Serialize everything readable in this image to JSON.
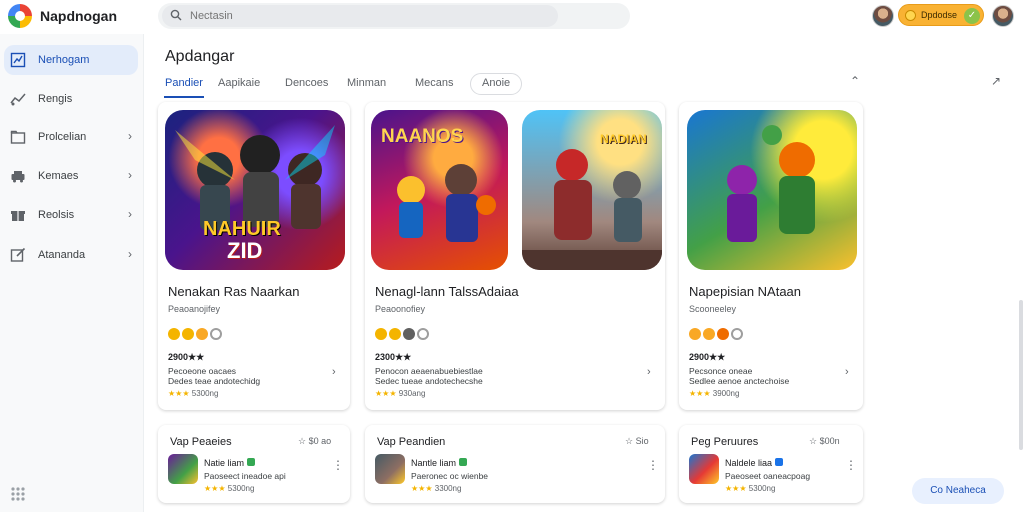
{
  "app": {
    "title": "Napdnogan"
  },
  "search": {
    "placeholder": "Nectasin",
    "value": ""
  },
  "header": {
    "points_label": "Dpdodse"
  },
  "sidebar": {
    "items": [
      {
        "label": "Nerhogam",
        "active": true,
        "icon": "chart-icon",
        "has_chevron": false
      },
      {
        "label": "Rengis",
        "active": false,
        "icon": "trend-icon",
        "has_chevron": false
      },
      {
        "label": "Prolcelian",
        "active": false,
        "icon": "folder-icon",
        "has_chevron": true
      },
      {
        "label": "Kemaes",
        "active": false,
        "icon": "car-icon",
        "has_chevron": true
      },
      {
        "label": "Reolsis",
        "active": false,
        "icon": "gift-icon",
        "has_chevron": true
      },
      {
        "label": "Atananda",
        "active": false,
        "icon": "edit-icon",
        "has_chevron": true
      }
    ]
  },
  "main": {
    "section_title": "Apdangar",
    "tabs": [
      "Pandier",
      "Aapikaie",
      "Dencoes",
      "Minman",
      "Mecans",
      "Anoie"
    ]
  },
  "cards": [
    {
      "art_text_top": "NAHUIR",
      "art_text_bottom": "ZID",
      "title": "Nenakan Ras Naarkan",
      "subtitle": "Peaoanojifey",
      "rating_dots": [
        "#f4b400",
        "#f4b400",
        "#f9a825",
        "#9e9e9e"
      ],
      "meta_strong": "2900★★",
      "meta_line1": "Pecoeone oacaes",
      "meta_line2": "Dedes teae andotechidg",
      "meta_rating": "5300ng",
      "colors": {
        "bg1": "#1a237e",
        "bg2": "#b71c1c",
        "accent": "#ffca28"
      }
    },
    {
      "art_text_top": "NAANOS",
      "title": "Nenagl-lann TalssAdaiaa",
      "subtitle": "Peaoonofiey",
      "rating_dots": [
        "#f4b400",
        "#f4b400",
        "#616161",
        "#9e9e9e"
      ],
      "meta_strong": "2300★★",
      "meta_line1": "Penocon aeaenabuebiestlae",
      "meta_line2": "Sedec tueae andotechecshe",
      "meta_rating": "930ang",
      "colors": {
        "bg1": "#4a148c",
        "bg2": "#e65100",
        "accent": "#ffd54f"
      }
    },
    {
      "art_text_top": "NADIAN",
      "title": "",
      "subtitle": "",
      "colors": {
        "bg1": "#29b6f6",
        "bg2": "#8d6e63",
        "accent": "#ffca28"
      }
    },
    {
      "title": "Napepisian NAtaan",
      "subtitle": "Scooneeley",
      "rating_dots": [
        "#f9a825",
        "#f9a825",
        "#ef6c00",
        "#9e9e9e"
      ],
      "meta_strong": "2900★★",
      "meta_line1": "Pecsonce oneae",
      "meta_line2": "Sedlee aenoe anctechoise",
      "meta_rating": "3900ng",
      "colors": {
        "bg1": "#7b1fa2",
        "bg2": "#fbc02d",
        "accent": "#43a047"
      }
    }
  ],
  "mini_cards": [
    {
      "title": "Vap Peaeies",
      "price": "☆ $0 ao",
      "name": "Natie liam",
      "desc": "Paoseect ineadoe api",
      "rating": "5300ng"
    },
    {
      "title": "Vap Peandien",
      "price": "☆ Sio",
      "name": "Nantle liam",
      "desc": "Paeronec oc wienbe",
      "rating": "3300ng"
    },
    {
      "title": "Peg Peruures",
      "price": "☆ $00n",
      "name": "Naldele liaa",
      "desc": "Paeoseet oaneacpoag",
      "rating": "5300ng"
    }
  ],
  "cta": {
    "label": "Co Neaheca"
  }
}
